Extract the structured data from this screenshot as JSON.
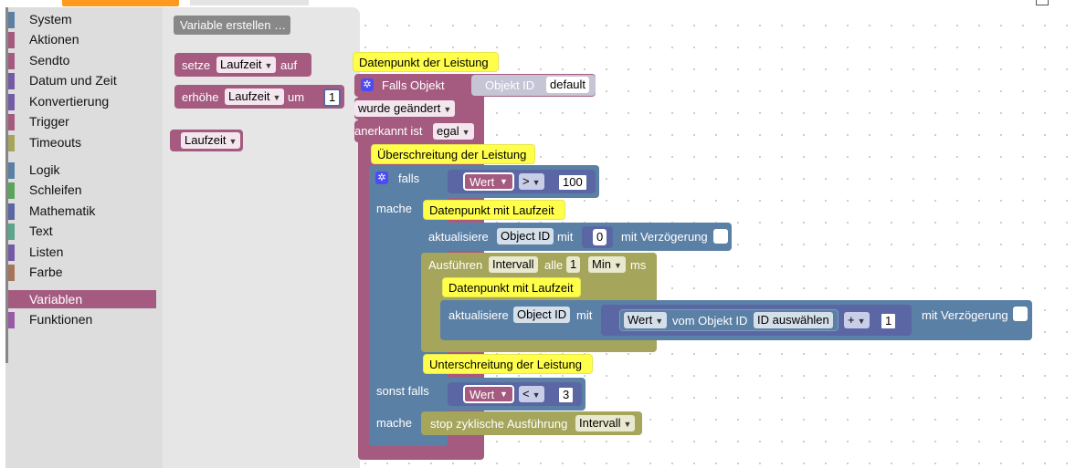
{
  "toolbox": {
    "categories": [
      {
        "label": "System",
        "color": "#5b80a5"
      },
      {
        "label": "Aktionen",
        "color": "#a55b80"
      },
      {
        "label": "Sendto",
        "color": "#a55b80"
      },
      {
        "label": "Datum und Zeit",
        "color": "#745ba5"
      },
      {
        "label": "Konvertierung",
        "color": "#745ba5"
      },
      {
        "label": "Trigger",
        "color": "#a55b80"
      },
      {
        "label": "Timeouts",
        "color": "#a5a55b"
      },
      {
        "label": "Logik",
        "color": "#5b80a5"
      },
      {
        "label": "Schleifen",
        "color": "#5ba55b"
      },
      {
        "label": "Mathematik",
        "color": "#5b67a5"
      },
      {
        "label": "Text",
        "color": "#5ba58c"
      },
      {
        "label": "Listen",
        "color": "#745ba5"
      },
      {
        "label": "Farbe",
        "color": "#a5745b"
      },
      {
        "label": "Variablen",
        "color": "#a55b80",
        "selected": true
      },
      {
        "label": "Funktionen",
        "color": "#995ba5"
      }
    ]
  },
  "flyout": {
    "create_variable": "Variable erstellen …",
    "set_block": {
      "label": "setze",
      "var": "Laufzeit",
      "suffix": "auf"
    },
    "change_block": {
      "label": "erhöhe",
      "var": "Laufzeit",
      "suffix": "um",
      "value": "1"
    },
    "get_block": {
      "var": "Laufzeit"
    }
  },
  "canvas": {
    "comment_main": "Datenpunkt der Leistung",
    "trigger": {
      "label": "Falls Objekt",
      "object_label": "Objekt ID",
      "object_value": "default",
      "changed": "wurde geändert",
      "ack_label": "anerkannt ist",
      "ack_value": "egal"
    },
    "comment_over": "Überschreitung der Leistung",
    "if_label": "falls",
    "cond1": {
      "var": "Wert",
      "op": ">",
      "value": "100"
    },
    "then_label": "mache",
    "comment_runtime1": "Datenpunkt mit Laufzeit",
    "update1": {
      "label": "aktualisiere",
      "object": "Object ID",
      "mit": "mit",
      "value": "0",
      "delay": "mit Verzögerung"
    },
    "interval": {
      "label": "Ausführen",
      "var": "Intervall",
      "alle": "alle",
      "value": "1",
      "unit": "Min",
      "suffix": "ms"
    },
    "comment_runtime2": "Datenpunkt mit Laufzeit",
    "update2": {
      "label": "aktualisiere",
      "object": "Object ID",
      "mit": "mit",
      "wert": "Wert",
      "from_obj": "vom Objekt ID",
      "select": "ID auswählen",
      "op": "+",
      "value": "1",
      "delay": "mit Verzögerung"
    },
    "comment_under": "Unterschreitung der Leistung",
    "elseif_label": "sonst falls",
    "cond2": {
      "var": "Wert",
      "op": "<",
      "value": "3"
    },
    "then2_label": "mache",
    "stop": {
      "label": "stop zyklische Ausführung",
      "var": "Intervall"
    }
  }
}
